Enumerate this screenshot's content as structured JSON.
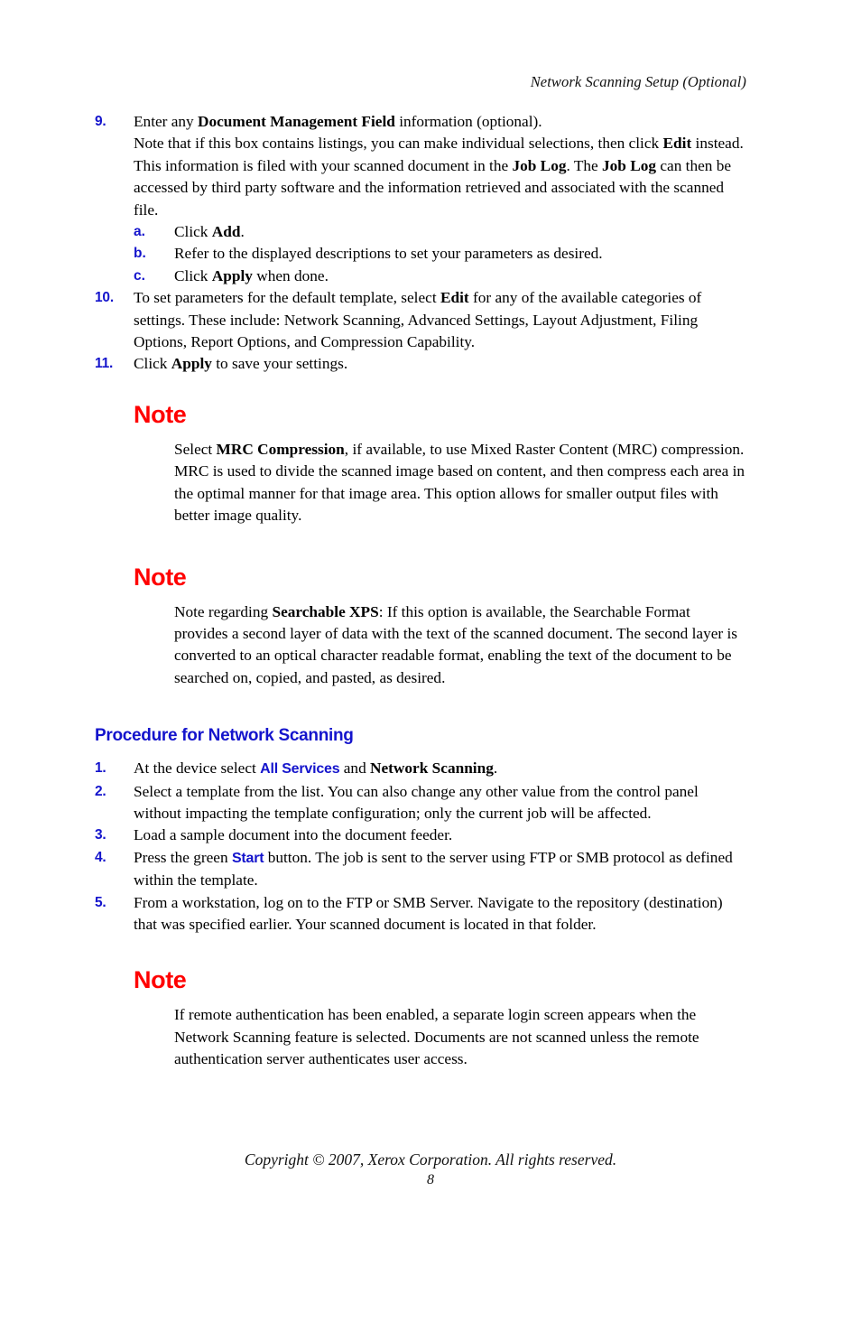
{
  "page": {
    "running_header": "Network Scanning Setup (Optional)",
    "page_number": "8",
    "copyright": "Copyright © 2007, Xerox Corporation. All rights reserved.",
    "colors": {
      "accent_blue": "#1414CC",
      "note_red": "#FF0000",
      "body_black": "#000000",
      "background": "#FFFFFF"
    }
  },
  "steps": {
    "item9": {
      "num": "9.",
      "line1_a": "Enter any ",
      "line1_b": "Document Management Field",
      "line1_c": " information (optional).",
      "line2_a": "Note that if this box contains listings, you can make individual selections, then click ",
      "line2_b": "Edit",
      "line2_c": " instead. This information is filed with your scanned document in the ",
      "line2_d": "Job Log",
      "line2_e": ". The ",
      "line2_f": "Job Log",
      "line2_g": " can then be accessed by third party software and the information retrieved and associated with the scanned file."
    },
    "sub": [
      {
        "num": "a.",
        "pre": "Click ",
        "bold": "Add",
        "post": "."
      },
      {
        "num": "b.",
        "pre": "Refer to the displayed descriptions to set your parameters as desired.",
        "bold": "",
        "post": ""
      },
      {
        "num": "c.",
        "pre": "Click ",
        "bold": "Apply",
        "post": " when done."
      }
    ],
    "item10": {
      "num": "10.",
      "pre": "To set parameters for the default template, select ",
      "bold": "Edit",
      "post": " for any of the available categories of settings. These include: Network Scanning, Advanced Settings, Layout Adjustment, Filing Options, Report Options, and Compression Capability."
    },
    "item11": {
      "num": "11.",
      "pre": "Click ",
      "bold": "Apply",
      "post": " to save your settings."
    }
  },
  "notes": {
    "note1": {
      "title": "Note",
      "pre": "Select ",
      "bold": "MRC Compression",
      "post": ", if available, to use Mixed Raster Content (MRC) compression. MRC is used to divide the scanned image based on content, and then compress each area in the optimal manner for that image area. This option allows for smaller output files with better image quality."
    },
    "note2": {
      "title": "Note",
      "pre": "Note regarding ",
      "bold": "Searchable XPS",
      "post": ": If this option is available, the Searchable Format provides a second layer of data with the text of the scanned document. The second layer is converted to an optical character readable format, enabling the text of the document to be searched on, copied, and pasted, as desired."
    },
    "note3": {
      "title": "Note",
      "body": "If remote authentication has been enabled, a separate login screen appears when the Network Scanning feature is selected. Documents are not scanned unless the remote authentication server authenticates user access."
    }
  },
  "procedure": {
    "heading": "Procedure for Network Scanning",
    "step1": {
      "num": "1.",
      "pre": "At the device select ",
      "ui": "All Services",
      "mid": " and ",
      "bold": "Network Scanning",
      "post": "."
    },
    "step2": {
      "num": "2.",
      "text": "Select a template from the list. You can also change any other value from the control panel without impacting the template configuration; only the current job will be affected."
    },
    "step3": {
      "num": "3.",
      "text": "Load a sample document into the document feeder."
    },
    "step4": {
      "num": "4.",
      "pre": "Press the green ",
      "ui": "Start",
      "post": " button. The job is sent to the server using FTP or SMB protocol as defined within the template."
    },
    "step5": {
      "num": "5.",
      "text": "From a workstation, log on to the FTP or SMB Server. Navigate to the repository (destination) that was specified earlier. Your scanned document is located in that folder."
    }
  }
}
